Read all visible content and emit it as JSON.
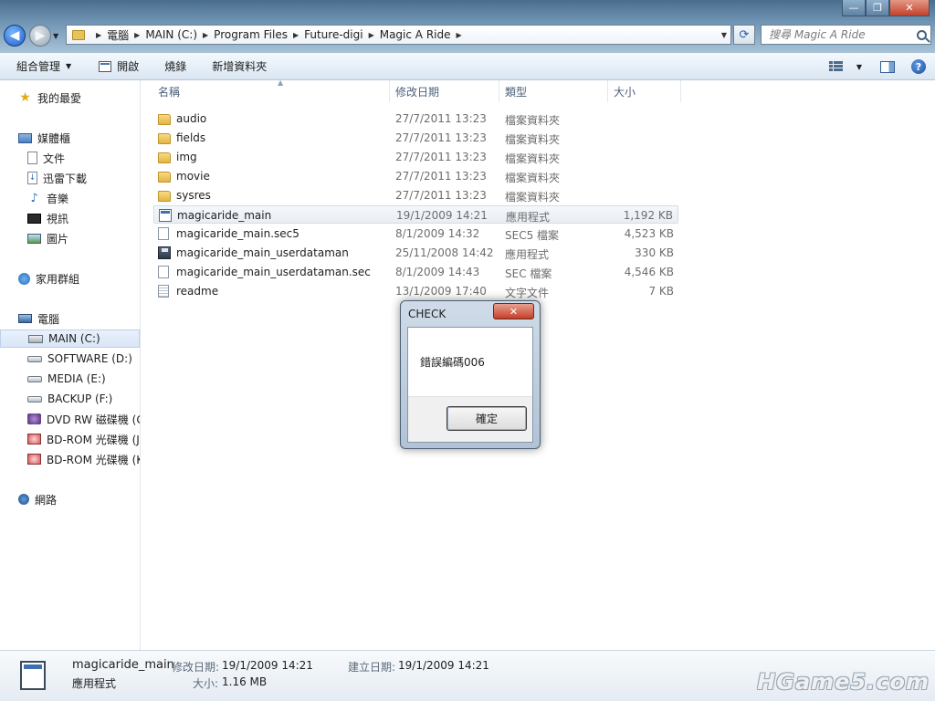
{
  "window": {
    "minimize_glyph": "—",
    "maximize_glyph": "❐",
    "close_glyph": "✕"
  },
  "address_bar": {
    "breadcrumbs": [
      "電腦",
      "MAIN (C:)",
      "Program Files",
      "Future-digi",
      "Magic A Ride"
    ]
  },
  "search": {
    "placeholder": "搜尋 Magic A Ride"
  },
  "toolbar": {
    "organize_label": "組合管理",
    "open_label": "開啟",
    "burn_label": "燒錄",
    "new_folder_label": "新增資料夾"
  },
  "nav": {
    "favorites": "我的最愛",
    "libraries": "媒體櫃",
    "documents": "文件",
    "xunlei": "迅雷下載",
    "music": "音樂",
    "videos": "視訊",
    "pictures": "圖片",
    "homegroup": "家用群組",
    "computer": "電腦",
    "drive_c": "MAIN (C:)",
    "drive_d": "SOFTWARE (D:)",
    "drive_e": "MEDIA (E:)",
    "drive_f": "BACKUP (F:)",
    "dvd": "DVD RW 磁碟機 (G",
    "bd1": "BD-ROM 光碟機 (J",
    "bd2": "BD-ROM 光碟機 (K",
    "network": "網路"
  },
  "columns": {
    "name": "名稱",
    "modified": "修改日期",
    "type": "類型",
    "size": "大小"
  },
  "files": [
    {
      "name": "audio",
      "date": "27/7/2011 13:23",
      "type": "檔案資料夾",
      "size": ""
    },
    {
      "name": "fields",
      "date": "27/7/2011 13:23",
      "type": "檔案資料夾",
      "size": ""
    },
    {
      "name": "img",
      "date": "27/7/2011 13:23",
      "type": "檔案資料夾",
      "size": ""
    },
    {
      "name": "movie",
      "date": "27/7/2011 13:23",
      "type": "檔案資料夾",
      "size": ""
    },
    {
      "name": "sysres",
      "date": "27/7/2011 13:23",
      "type": "檔案資料夾",
      "size": ""
    },
    {
      "name": "magicaride_main",
      "date": "19/1/2009 14:21",
      "type": "應用程式",
      "size": "1,192 KB"
    },
    {
      "name": "magicaride_main.sec5",
      "date": "8/1/2009 14:32",
      "type": "SEC5 檔案",
      "size": "4,523 KB"
    },
    {
      "name": "magicaride_main_userdataman",
      "date": "25/11/2008 14:42",
      "type": "應用程式",
      "size": "330 KB"
    },
    {
      "name": "magicaride_main_userdataman.sec",
      "date": "8/1/2009 14:43",
      "type": "SEC 檔案",
      "size": "4,546 KB"
    },
    {
      "name": "readme",
      "date": "13/1/2009 17:40",
      "type": "文字文件",
      "size": "7 KB"
    }
  ],
  "dialog": {
    "title": "CHECK",
    "message": "錯誤編碼006",
    "ok_label": "確定"
  },
  "details": {
    "name": "magicaride_main",
    "type": "應用程式",
    "modified_label": "修改日期:",
    "modified_value": "19/1/2009 14:21",
    "created_label": "建立日期:",
    "created_value": "19/1/2009 14:21",
    "size_label": "大小:",
    "size_value": "1.16 MB"
  },
  "watermark": "HGame5.com"
}
